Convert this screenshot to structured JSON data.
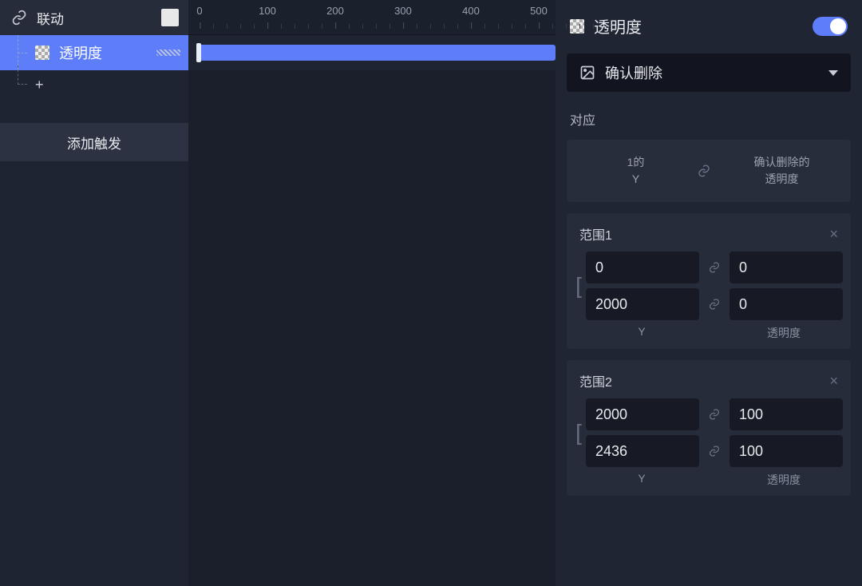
{
  "left": {
    "header_title": "联动",
    "layer_title": "透明度",
    "trigger_button": "添加触发",
    "add_plus": "+"
  },
  "ruler_ticks": [
    0,
    100,
    200,
    300,
    400,
    500
  ],
  "right": {
    "header_title": "透明度",
    "dropdown_label": "确认删除",
    "section_map": "对应",
    "map_left_line1": "1的",
    "map_left_line2": "Y",
    "map_right_line1": "确认删除的",
    "map_right_line2": "透明度",
    "ranges": [
      {
        "title": "范围1",
        "from_start": "0",
        "to_start": "0",
        "from_end": "2000",
        "to_end": "0",
        "label_left": "Y",
        "label_right": "透明度"
      },
      {
        "title": "范围2",
        "from_start": "2000",
        "to_start": "100",
        "from_end": "2436",
        "to_end": "100",
        "label_left": "Y",
        "label_right": "透明度"
      }
    ]
  }
}
